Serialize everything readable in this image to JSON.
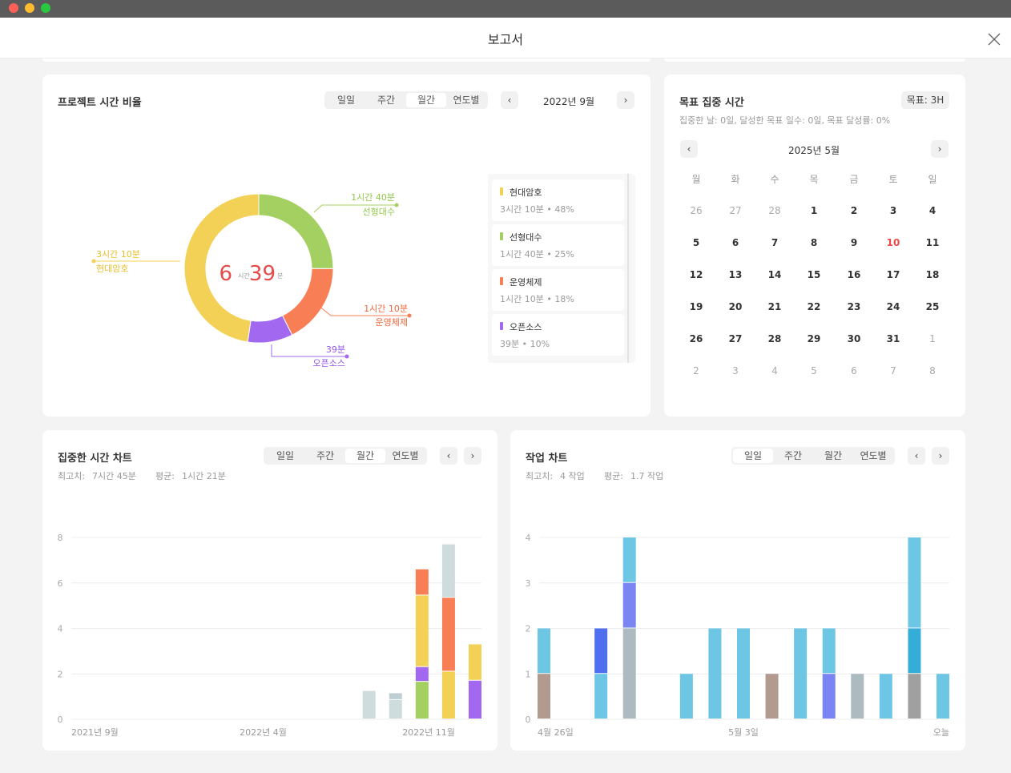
{
  "window": {
    "title": "보고서"
  },
  "colors": {
    "yellow": "#f3d156",
    "green": "#a3d061",
    "orange": "#f87f55",
    "purple": "#a268f0",
    "gray": "#cfdcde",
    "red": "#e84a4a"
  },
  "project_ratio": {
    "title": "프로젝트 시간 비율",
    "tabs": [
      "일일",
      "주간",
      "월간",
      "연도별"
    ],
    "active_tab": "월간",
    "period": "2022년 9월",
    "prev_icon": "‹",
    "next_icon": "›",
    "center": {
      "hours": "6",
      "hours_unit": "시간",
      "minutes": "39",
      "minutes_unit": "분"
    },
    "callouts": [
      {
        "time": "1시간 40분",
        "name": "선형대수"
      },
      {
        "time": "1시간 10분",
        "name": "운영체제"
      },
      {
        "time": "39분",
        "name": "오픈소스"
      },
      {
        "time": "3시간 10분",
        "name": "현대암호"
      }
    ],
    "legend": [
      {
        "name": "현대암호",
        "meta": "3시간 10분 • 48%"
      },
      {
        "name": "선형대수",
        "meta": "1시간 40분 • 25%"
      },
      {
        "name": "운영체제",
        "meta": "1시간 10분 • 18%"
      },
      {
        "name": "오픈소스",
        "meta": "39분 • 10%"
      }
    ]
  },
  "goal": {
    "title": "목표 집중 시간",
    "badge": "목표: 3H",
    "summary": "집중한 날: 0일, 달성한 목표 일수: 0일, 목표 달성률: 0%",
    "month": "2025년 5월",
    "weekdays": [
      "월",
      "화",
      "수",
      "목",
      "금",
      "토",
      "일"
    ],
    "weeks": [
      [
        "26",
        "27",
        "28",
        "1",
        "2",
        "3",
        "4"
      ],
      [
        "5",
        "6",
        "7",
        "8",
        "9",
        "10",
        "11"
      ],
      [
        "12",
        "13",
        "14",
        "15",
        "16",
        "17",
        "18"
      ],
      [
        "19",
        "20",
        "21",
        "22",
        "23",
        "24",
        "25"
      ],
      [
        "26",
        "27",
        "28",
        "29",
        "30",
        "31",
        "1"
      ],
      [
        "2",
        "3",
        "4",
        "5",
        "6",
        "7",
        "8"
      ]
    ]
  },
  "focus_chart": {
    "title": "집중한 시간 차트",
    "max_label": "최고치:",
    "max_value": "7시간 45분",
    "avg_label": "평균:",
    "avg_value": "1시간 21분",
    "tabs": [
      "일일",
      "주간",
      "월간",
      "연도별"
    ],
    "active_tab": "월간"
  },
  "task_chart": {
    "title": "작업 차트",
    "max_label": "최고치:",
    "max_value": "4 작업",
    "avg_label": "평균:",
    "avg_value": "1.7 작업",
    "tabs": [
      "일일",
      "주간",
      "월간",
      "연도별"
    ],
    "active_tab": "일일"
  },
  "chart_data": [
    {
      "type": "pie",
      "labels": [
        "현대암호",
        "선형대수",
        "운영체제",
        "오픈소스"
      ],
      "values": [
        190,
        100,
        70,
        39
      ],
      "unit": "분",
      "colors": [
        "#f3d156",
        "#a3d061",
        "#f87f55",
        "#a268f0"
      ]
    },
    {
      "type": "bar",
      "stacked": true,
      "x_tick_labels": [
        "2021년 9월",
        "2022년 4월",
        "2022년 11월"
      ],
      "tick_index": [
        0,
        7,
        14
      ],
      "categories_count": 15,
      "ylim": [
        0,
        8
      ],
      "yticks": [
        0,
        2,
        4,
        6,
        8
      ],
      "grid": true,
      "bars": [
        {
          "index": 11,
          "segments": [
            {
              "color": "#cfdcde",
              "value": 1.25
            }
          ]
        },
        {
          "index": 12,
          "segments": [
            {
              "color": "#cfdcde",
              "value": 0.85
            },
            {
              "color": "#bfced2",
              "value": 0.3
            }
          ]
        },
        {
          "index": 13,
          "segments": [
            {
              "color": "#a3d061",
              "value": 1.65
            },
            {
              "color": "#a268f0",
              "value": 0.65
            },
            {
              "color": "#f3d156",
              "value": 3.15
            },
            {
              "color": "#f87f55",
              "value": 1.15
            }
          ]
        },
        {
          "index": 14,
          "segments": [
            {
              "color": "#f3d156",
              "value": 2.1
            },
            {
              "color": "#f87f55",
              "value": 3.25
            },
            {
              "color": "#cfdcde",
              "value": 2.35
            }
          ]
        },
        {
          "index": 15,
          "segments": [
            {
              "color": "#a268f0",
              "value": 1.7
            },
            {
              "color": "#f3d156",
              "value": 1.6
            }
          ]
        }
      ]
    },
    {
      "type": "bar",
      "stacked": true,
      "x_tick_labels": [
        "4월 26일",
        "5월 3일",
        "오늘"
      ],
      "tick_index": [
        0,
        7,
        14
      ],
      "categories_count": 15,
      "ylim": [
        0,
        4
      ],
      "yticks": [
        0,
        1,
        2,
        3,
        4
      ],
      "grid": true,
      "bars": [
        {
          "index": 0,
          "segments": [
            {
              "color": "#b29a8e",
              "value": 1
            },
            {
              "color": "#6ec6e5",
              "value": 1
            }
          ]
        },
        {
          "index": 2,
          "segments": [
            {
              "color": "#6ec6e5",
              "value": 1
            },
            {
              "color": "#506fef",
              "value": 1
            }
          ]
        },
        {
          "index": 3,
          "segments": [
            {
              "color": "#acbbc0",
              "value": 2
            },
            {
              "color": "#7a85f2",
              "value": 1
            },
            {
              "color": "#6ec6e5",
              "value": 1
            }
          ]
        },
        {
          "index": 5,
          "segments": [
            {
              "color": "#6ec6e5",
              "value": 1
            }
          ]
        },
        {
          "index": 6,
          "segments": [
            {
              "color": "#6ec6e5",
              "value": 2
            }
          ]
        },
        {
          "index": 7,
          "segments": [
            {
              "color": "#6ec6e5",
              "value": 2
            }
          ]
        },
        {
          "index": 8,
          "segments": [
            {
              "color": "#b29a8e",
              "value": 1
            }
          ]
        },
        {
          "index": 9,
          "segments": [
            {
              "color": "#6ec6e5",
              "value": 2
            }
          ]
        },
        {
          "index": 10,
          "segments": [
            {
              "color": "#7a85f2",
              "value": 1
            },
            {
              "color": "#6ec6e5",
              "value": 1
            }
          ]
        },
        {
          "index": 11,
          "segments": [
            {
              "color": "#acbbc0",
              "value": 1
            }
          ]
        },
        {
          "index": 12,
          "segments": [
            {
              "color": "#6ec6e5",
              "value": 1
            }
          ]
        },
        {
          "index": 13,
          "segments": [
            {
              "color": "#a0a0a0",
              "value": 1
            },
            {
              "color": "#36acd9",
              "value": 1
            },
            {
              "color": "#6ec6e5",
              "value": 2
            }
          ]
        },
        {
          "index": 14,
          "segments": [
            {
              "color": "#6ec6e5",
              "value": 1
            }
          ]
        }
      ]
    }
  ]
}
